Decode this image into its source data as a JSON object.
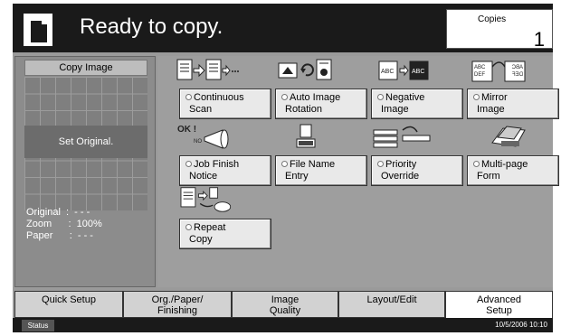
{
  "header": {
    "title": "Ready to copy.",
    "copies_label": "Copies",
    "copies_value": "1"
  },
  "left_panel": {
    "copy_image_label": "Copy Image",
    "set_original": "Set Original.",
    "original_line": "Original  :  - - -",
    "zoom_line": "Zoom      :  100%",
    "paper_line": "Paper      :  - - -"
  },
  "functions": [
    {
      "line1": "Continuous",
      "line2": "Scan",
      "icon": "continuous-scan-icon"
    },
    {
      "line1": "Auto Image",
      "line2": "Rotation",
      "icon": "auto-rotation-icon"
    },
    {
      "line1": "Negative",
      "line2": "Image",
      "icon": "negative-image-icon"
    },
    {
      "line1": "Mirror",
      "line2": "Image",
      "icon": "mirror-image-icon"
    },
    {
      "line1": "Job Finish",
      "line2": "Notice",
      "icon": "job-finish-icon"
    },
    {
      "line1": "File Name",
      "line2": "Entry",
      "icon": "file-name-icon"
    },
    {
      "line1": "Priority",
      "line2": "Override",
      "icon": "priority-override-icon"
    },
    {
      "line1": "Multi-page",
      "line2": "Form",
      "icon": "multi-page-form-icon"
    },
    {
      "line1": "Repeat",
      "line2": "Copy",
      "icon": "repeat-copy-icon"
    }
  ],
  "icon_text": {
    "abc": "ABC",
    "def": "DEF",
    "ok": "OK !",
    "no": "NO"
  },
  "tabs": [
    {
      "line1": "Quick Setup",
      "line2": ""
    },
    {
      "line1": "Org./Paper/",
      "line2": "Finishing"
    },
    {
      "line1": "Image",
      "line2": "Quality"
    },
    {
      "line1": "Layout/Edit",
      "line2": ""
    },
    {
      "line1": "Advanced",
      "line2": "Setup"
    }
  ],
  "status": {
    "button": "Status",
    "datetime": "10/5/2006   10:10"
  }
}
